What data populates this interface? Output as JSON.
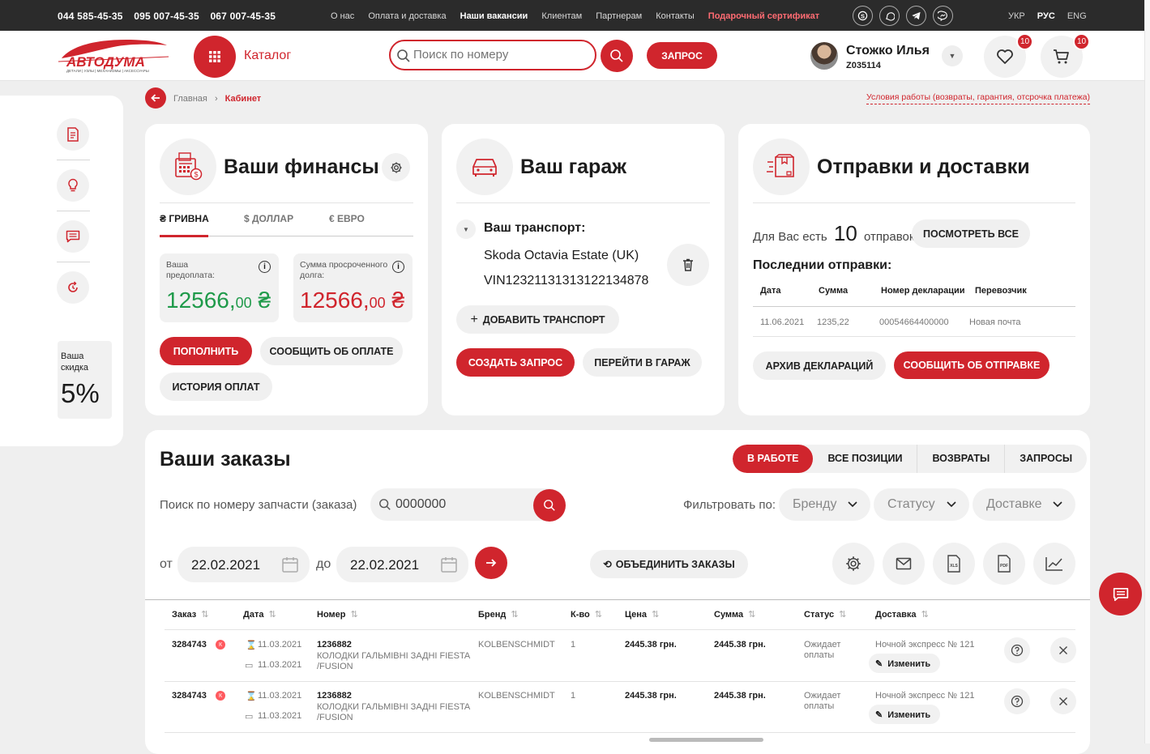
{
  "topbar": {
    "phones": [
      "044 585-45-35",
      "095 007-45-35",
      "067 007-45-35"
    ],
    "nav": [
      "О нас",
      "Оплата и доставка",
      "Наши вакансии",
      "Клиентам",
      "Партнерам",
      "Контакты"
    ],
    "gift": "Подарочный сертификат",
    "socials": [
      "skype-icon",
      "viber-icon",
      "telegram-icon",
      "messenger-icon"
    ],
    "langs": [
      "УКР",
      "РУС",
      "ENG"
    ]
  },
  "header": {
    "logo_text": "АВТОДУМА",
    "logo_sub": "ДЕТАЛИ | УЗЛЫ | МЕХАНИЗМЫ | АКСЕССУАРЫ",
    "catalog": "Каталог",
    "search_placeholder": "Поиск по номеру",
    "request": "ЗАПРОС",
    "user_name": "Стожко Илья",
    "user_id": "Z035114",
    "favorites_count": "10",
    "cart_count": "10"
  },
  "rail": {
    "discount_label": "Ваша скидка",
    "discount_value": "5%"
  },
  "breadcrumbs": {
    "home": "Главная",
    "current": "Кабинет",
    "terms": "Условия работы (возвраты, гарантия, отсрочка платежа)"
  },
  "finance": {
    "title": "Ваши финансы",
    "tabs": [
      "₴ ГРИВНА",
      "$ ДОЛЛАР",
      "€ ЕВРО"
    ],
    "prepay_label": "Ваша предоплата:",
    "prepay_int": "12566,",
    "prepay_dec": "00",
    "overdue_label": "Сумма просроченного долга:",
    "overdue_int": "12566,",
    "overdue_dec": "00",
    "currency": "₴",
    "btn_topup": "ПОПОЛНИТЬ",
    "btn_report": "СООБЩИТЬ ОБ ОПЛАТЕ",
    "btn_history": "ИСТОРИЯ ОПЛАТ"
  },
  "garage": {
    "title": "Ваш гараж",
    "transport_label": "Ваш транспорт:",
    "car": "Skoda Octavia Estate (UK)",
    "vin": "VIN12321131313122134878",
    "btn_add": "ДОБАВИТЬ ТРАНСПОРТ",
    "btn_create": "СОЗДАТЬ ЗАПРОС",
    "btn_goto": "ПЕРЕЙТИ В ГАРАЖ"
  },
  "shipping": {
    "title": "Отправки и доставки",
    "count_pre": "Для Вас есть",
    "count": "10",
    "count_post": "отправок",
    "btn_all": "ПОСМОТРЕТЬ ВСЕ",
    "recent_title": "Последнии отправки:",
    "columns": [
      "Дата",
      "Сумма",
      "Номер декларации",
      "Перевозчик"
    ],
    "row": [
      "11.06.2021",
      "1235,22",
      "00054664400000",
      "Новая почта"
    ],
    "btn_archive": "АРХИВ ДЕКЛАРАЦИЙ",
    "btn_report": "СООБЩИТЬ ОБ ОТПРАВКЕ"
  },
  "orders": {
    "title": "Ваши заказы",
    "tabs": [
      "В РАБОТЕ",
      "ВСЕ ПОЗИЦИИ",
      "ВОЗВРАТЫ",
      "ЗАПРОСЫ"
    ],
    "search_label": "Поиск по номеру запчасти (заказа)",
    "search_value": "0000000",
    "filter_label": "Фильтровать по:",
    "filters": [
      "Бренду",
      "Статусу",
      "Доставке"
    ],
    "from_label": "от",
    "to_label": "до",
    "date_from": "22.02.2021",
    "date_to": "22.02.2021",
    "merge": "ОБЪЕДИНИТЬ ЗАКАЗЫ",
    "columns": [
      "Заказ",
      "Дата",
      "Номер",
      "Бренд",
      "К-во",
      "Цена",
      "Сумма",
      "Статус",
      "Доставка"
    ],
    "rows": [
      {
        "order": "3284743",
        "badge": "К",
        "date1": "11.03.2021",
        "date2": "11.03.2021",
        "number": "1236882",
        "desc1": "КОЛОДКИ ГАЛЬМІВНІ ЗАДНІ FIESTA",
        "desc2": "/FUSION",
        "brand": "KOLBENSCHMIDT",
        "qty": "1",
        "price": "2445.38  грн.",
        "sum": "2445.38 грн.",
        "status1": "Ожидает",
        "status2": "оплаты",
        "delivery": "Ночной экспресс № 121",
        "edit": "Изменить"
      },
      {
        "order": "3284743",
        "badge": "К",
        "date1": "11.03.2021",
        "date2": "11.03.2021",
        "number": "1236882",
        "desc1": "КОЛОДКИ ГАЛЬМІВНІ ЗАДНІ FIESTA",
        "desc2": "/FUSION",
        "brand": "KOLBENSCHMIDT",
        "qty": "1",
        "price": "2445.38  грн.",
        "sum": "2445.38 грн.",
        "status1": "Ожидает",
        "status2": "оплаты",
        "delivery": "Ночной экспресс № 121",
        "edit": "Изменить"
      }
    ]
  },
  "colors": {
    "accent": "#d0252d",
    "positive": "#1f9a4a",
    "background": "#efefef"
  }
}
